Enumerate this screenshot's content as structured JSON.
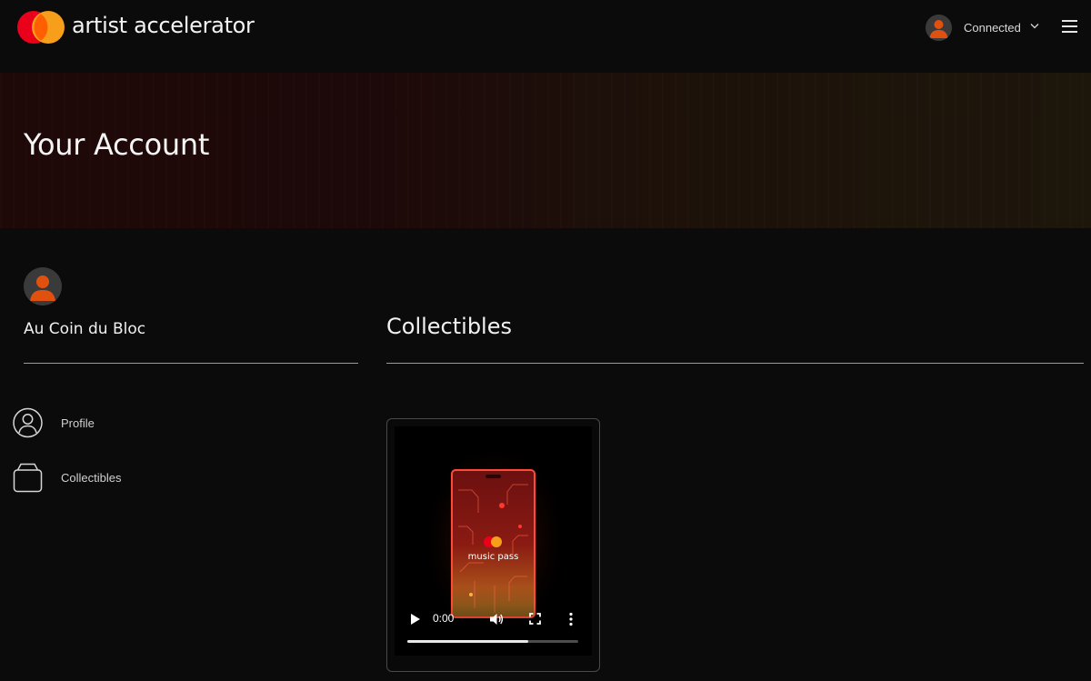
{
  "header": {
    "brand": "artist accelerator",
    "logo_icon": "mastercard-logo-icon",
    "user_status": "Connected",
    "avatar_icon": "user-avatar-icon",
    "menu_icon": "hamburger-menu-icon"
  },
  "hero": {
    "title": "Your Account"
  },
  "profile": {
    "username": "Au Coin du Bloc",
    "nav": [
      {
        "label": "Profile",
        "icon": "user-circle-icon"
      },
      {
        "label": "Collectibles",
        "icon": "collectibles-bag-icon"
      }
    ]
  },
  "main": {
    "section_title": "Collectibles",
    "items": [
      {
        "artwork_text": "music pass",
        "player": {
          "time": "0:00",
          "progress": 0.71
        }
      }
    ]
  },
  "colors": {
    "background": "#0b0b0b",
    "mastercard_red": "#eb001b",
    "mastercard_orange": "#f79e1b",
    "avatar_orange": "#e0510f"
  }
}
